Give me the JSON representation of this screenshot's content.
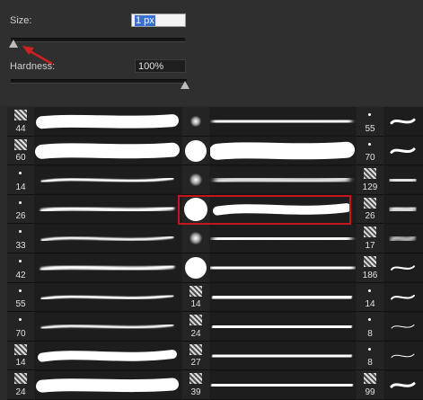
{
  "size": {
    "label": "Size:",
    "value": "1 px",
    "slider_fraction": 0.0
  },
  "hardness": {
    "label": "Hardness:",
    "value": "100%",
    "slider_fraction": 1.0
  },
  "brush_grid": {
    "col1_sizes": [
      "44",
      "60",
      "14",
      "26",
      "33",
      "42",
      "55",
      "70",
      "14",
      "24"
    ],
    "col2_sizes": [
      "",
      "",
      "",
      "",
      "",
      "",
      "14",
      "24",
      "27",
      "39"
    ],
    "col3_sizes": [
      "55",
      "70",
      "129",
      "26",
      "17",
      "186",
      "14",
      "8",
      "8",
      "99"
    ],
    "selected_index": 3,
    "selected_column": 2
  },
  "colors": {
    "annotation_arrow": "#d0201f",
    "selection_border": "#c4161c"
  }
}
